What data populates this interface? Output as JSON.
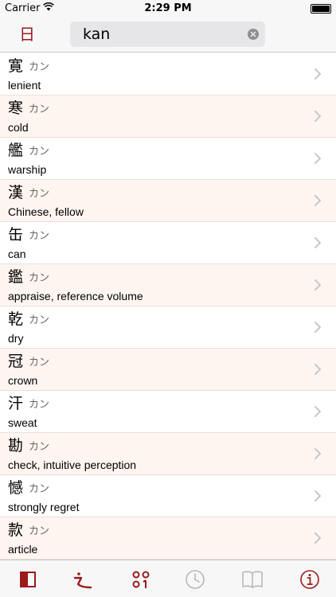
{
  "status_bar": {
    "carrier": "Carrier",
    "time": "2:29 PM"
  },
  "header": {
    "mode_toggle_label": "日",
    "search_value": "kan"
  },
  "results": [
    {
      "kanji": "寛",
      "reading": "カン",
      "meaning": "lenient"
    },
    {
      "kanji": "寒",
      "reading": "カン",
      "meaning": "cold"
    },
    {
      "kanji": "艦",
      "reading": "カン",
      "meaning": "warship"
    },
    {
      "kanji": "漢",
      "reading": "カン",
      "meaning": "Chinese, fellow"
    },
    {
      "kanji": "缶",
      "reading": "カン",
      "meaning": "can"
    },
    {
      "kanji": "鑑",
      "reading": "カン",
      "meaning": "appraise, reference volume"
    },
    {
      "kanji": "乾",
      "reading": "カン",
      "meaning": "dry"
    },
    {
      "kanji": "冠",
      "reading": "カン",
      "meaning": "crown"
    },
    {
      "kanji": "汗",
      "reading": "カン",
      "meaning": "sweat"
    },
    {
      "kanji": "勘",
      "reading": "カン",
      "meaning": "check, intuitive perception"
    },
    {
      "kanji": "憾",
      "reading": "カン",
      "meaning": "strongly regret"
    },
    {
      "kanji": "款",
      "reading": "カン",
      "meaning": "article"
    }
  ],
  "tab_bar": {
    "tabs": [
      {
        "icon": "sidebar-panel-icon",
        "active": false
      },
      {
        "icon": "radical-icon",
        "active": true
      },
      {
        "icon": "kana-grid-icon",
        "active": false
      },
      {
        "icon": "clock-icon",
        "active": false
      },
      {
        "icon": "book-icon",
        "active": false
      },
      {
        "icon": "info-icon",
        "active": false
      }
    ]
  },
  "colors": {
    "accent": "#9b1b1b",
    "row_alt": "#fef5f0",
    "inactive_icon": "#b8b8b8",
    "chevron": "#c7c7cc"
  }
}
